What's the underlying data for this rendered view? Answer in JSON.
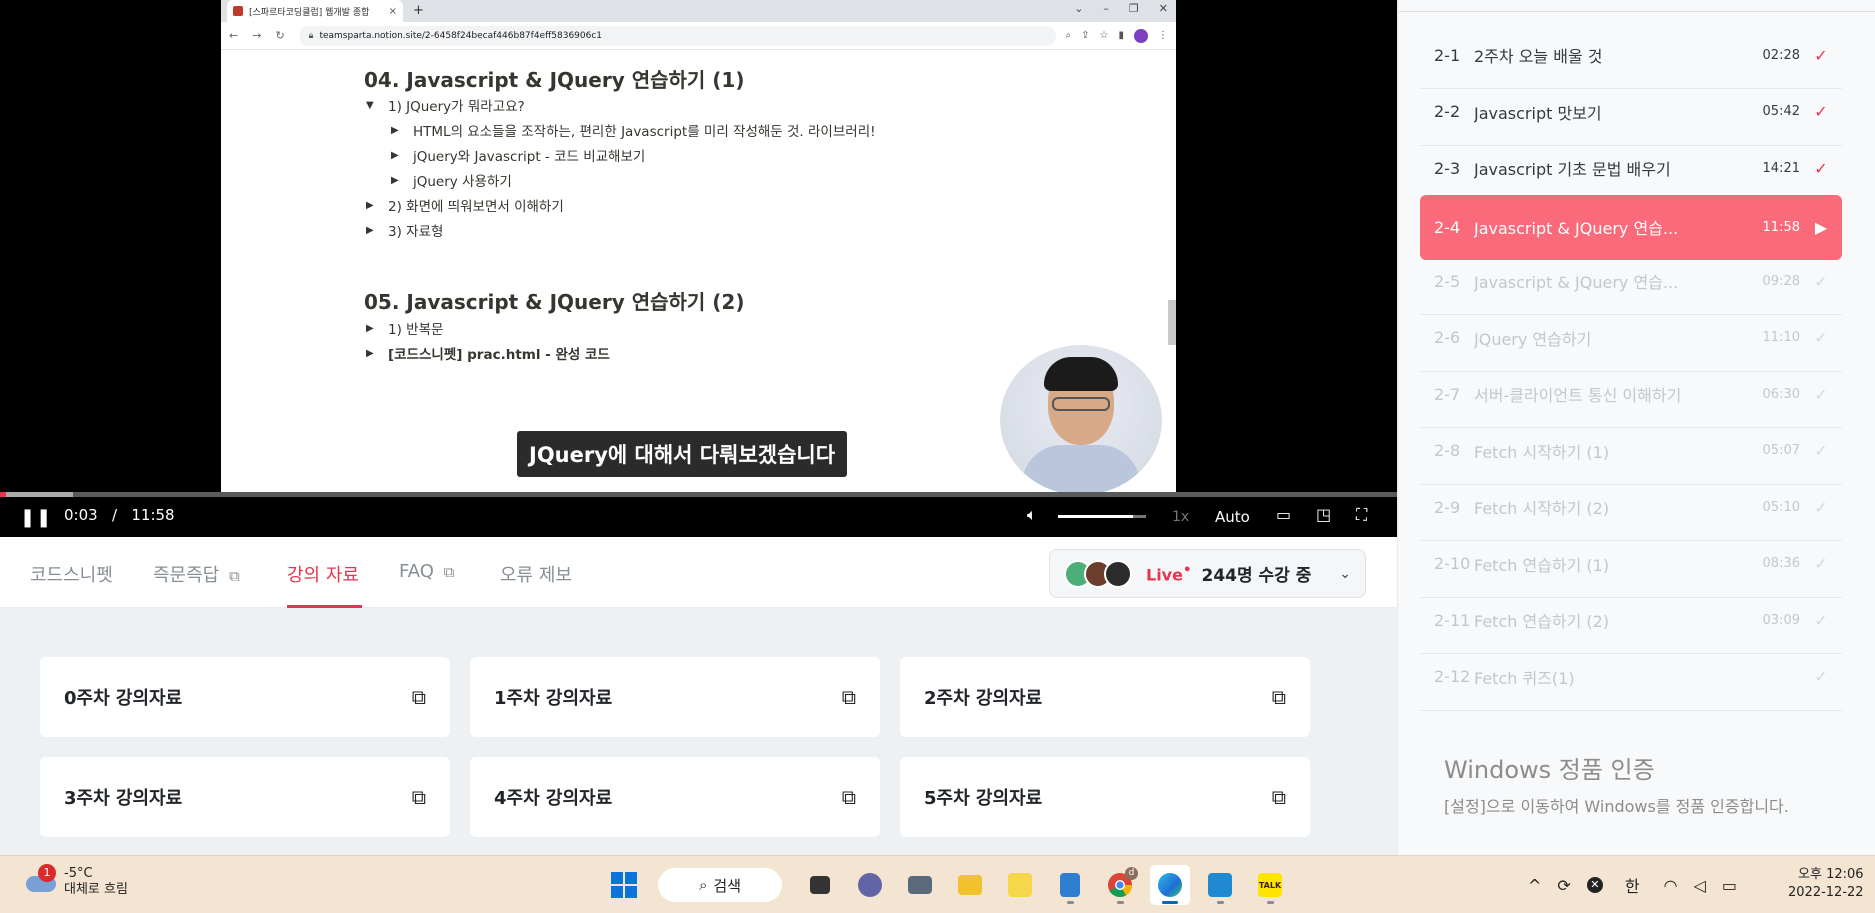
{
  "browser": {
    "tab_title": "[스파르타코딩클럽] 웹개발 종합",
    "tab_close": "×",
    "new_tab": "+",
    "url": "teamsparta.notion.site/2-6458f24becaf446b87f4eff5836906c1",
    "window_controls": [
      "⌄",
      "–",
      "❐",
      "✕"
    ]
  },
  "notion": {
    "heading_1": "04. Javascript & JQuery 연습하기 (1)",
    "heading_2": "05. Javascript & JQuery 연습하기 (2)",
    "toggles": [
      {
        "tri": "▼",
        "text": "1) JQuery가 뭐라고요?"
      },
      {
        "tri": "▶",
        "text": "HTML의 요소들을 조작하는, 편리한 Javascript를 미리 작성해둔 것. 라이브러리!"
      },
      {
        "tri": "▶",
        "text": "jQuery와 Javascript - 코드 비교해보기"
      },
      {
        "tri": "▶",
        "text": "jQuery 사용하기"
      },
      {
        "tri": "▶",
        "text": "2) 화면에 띄워보면서 이해하기"
      },
      {
        "tri": "▶",
        "text": "3) 자료형"
      },
      {
        "tri": "▶",
        "text": "1) 반복문"
      },
      {
        "tri": "▶",
        "text": "[코드스니펫] prac.html - 완성 코드"
      }
    ]
  },
  "player": {
    "subtitle": "JQuery에 대해서 다뤄보겠습니다",
    "pause_icon": "❚❚",
    "current_time": "0:03",
    "separator": "/",
    "duration": "11:58",
    "progress_fraction": 0.004,
    "buffered_fraction": 0.052,
    "volume_fraction": 0.85,
    "speed": "1x",
    "quality": "Auto",
    "icons": [
      "volume-icon",
      "subtitles-icon",
      "pip-icon",
      "fullscreen-icon"
    ]
  },
  "tabs": {
    "items": [
      {
        "label": "코드스니펫",
        "external": false
      },
      {
        "label": "즉문즉답",
        "external": true
      },
      {
        "label": "강의 자료",
        "external": false
      },
      {
        "label": "FAQ",
        "external": true
      },
      {
        "label": "오류 제보",
        "external": false
      }
    ],
    "external_icon": "⧉",
    "active_index": 2
  },
  "live": {
    "label": "Live",
    "marker": "•",
    "count_text": "244명 수강 중",
    "chevron": "⌄"
  },
  "materials": {
    "cards": [
      "0주차 강의자료",
      "1주차 강의자료",
      "2주차 강의자료",
      "3주차 강의자료",
      "4주차 강의자료",
      "5주차 강의자료"
    ],
    "link_icon": "⧉"
  },
  "lectures": [
    {
      "num": "2-1",
      "title": "2주차 오늘 배울 것",
      "duration": "02:28",
      "state": "done"
    },
    {
      "num": "2-2",
      "title": "Javascript 맛보기",
      "duration": "05:42",
      "state": "done"
    },
    {
      "num": "2-3",
      "title": "Javascript 기초 문법 배우기",
      "duration": "14:21",
      "state": "done"
    },
    {
      "num": "2-4",
      "title": "Javascript & JQuery 연습...",
      "duration": "11:58",
      "state": "current"
    },
    {
      "num": "2-5",
      "title": "Javascript & JQuery 연습...",
      "duration": "09:28",
      "state": "todo"
    },
    {
      "num": "2-6",
      "title": "JQuery 연습하기",
      "duration": "11:10",
      "state": "todo"
    },
    {
      "num": "2-7",
      "title": "서버-클라이언트 통신 이해하기",
      "duration": "06:30",
      "state": "todo"
    },
    {
      "num": "2-8",
      "title": "Fetch 시작하기 (1)",
      "duration": "05:07",
      "state": "todo"
    },
    {
      "num": "2-9",
      "title": "Fetch 시작하기 (2)",
      "duration": "05:10",
      "state": "todo"
    },
    {
      "num": "2-10",
      "title": "Fetch 연습하기 (1)",
      "duration": "08:36",
      "state": "todo"
    },
    {
      "num": "2-11",
      "title": "Fetch 연습하기 (2)",
      "duration": "03:09",
      "state": "todo"
    },
    {
      "num": "2-12",
      "title": "Fetch 퀴즈(1)",
      "duration": "",
      "state": "todo"
    }
  ],
  "check_icon": "✓",
  "play_icon": "▶",
  "watermark": {
    "title": "Windows 정품 인증",
    "subtitle": "[설정]으로 이동하여 Windows를 정품 인증합니다."
  },
  "taskbar": {
    "weather_badge": "1",
    "temperature": "-5°C",
    "condition": "대체로 흐림",
    "search_label": "검색",
    "search_icon": "⌕",
    "tray_chevron": "^",
    "ime": "한",
    "time": "오후 12:06",
    "date": "2022-12-22",
    "chrome_badge": "d",
    "kakao_label": "TALK"
  },
  "colors": {
    "accent": "#e8344e",
    "current_row": "#fb6a7a",
    "taskbar": "#f3e5d2"
  }
}
